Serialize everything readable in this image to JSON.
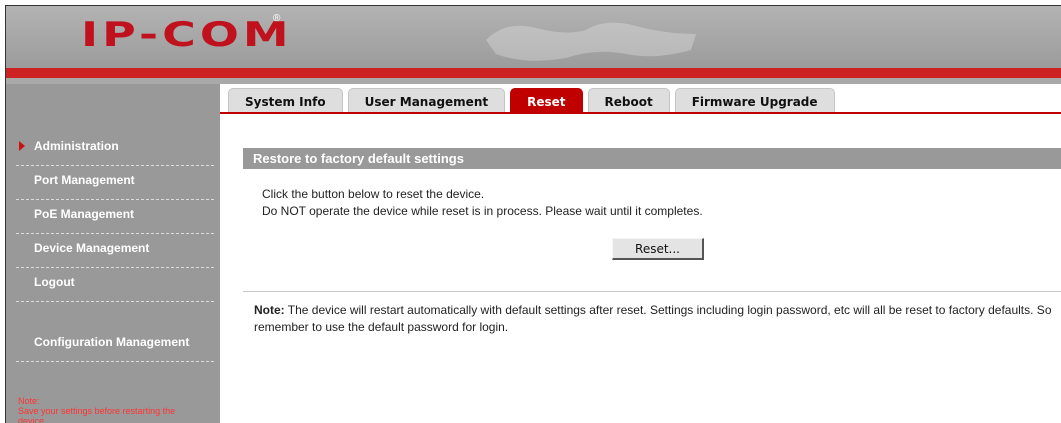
{
  "brand": {
    "logo": "IP-COM",
    "registered": "®"
  },
  "tabs": [
    {
      "label": "System Info",
      "active": false
    },
    {
      "label": "User Management",
      "active": false
    },
    {
      "label": "Reset",
      "active": true
    },
    {
      "label": "Reboot",
      "active": false
    },
    {
      "label": "Firmware Upgrade",
      "active": false
    }
  ],
  "sidebar": {
    "items": [
      {
        "label": "Administration",
        "active": true
      },
      {
        "label": "Port Management"
      },
      {
        "label": "PoE Management"
      },
      {
        "label": "Device Management"
      },
      {
        "label": "Logout"
      },
      {
        "label": "Configuration Management"
      }
    ],
    "note_title": "Note:",
    "note_text": "Save your settings before restarting the device."
  },
  "main": {
    "section_title": "Restore to factory default settings",
    "line1": "Click the button below to reset the device.",
    "line2": "Do NOT operate the device while reset is in process. Please wait until it completes.",
    "reset_button": "Reset...",
    "note_label": "Note:",
    "note_text": " The device will restart automatically with default settings after reset. Settings including login password, etc will all be reset to factory defaults. So remember to use the default password for login."
  },
  "colors": {
    "accent": "#c00000",
    "sidebar": "#999999",
    "note": "#ff3333"
  }
}
